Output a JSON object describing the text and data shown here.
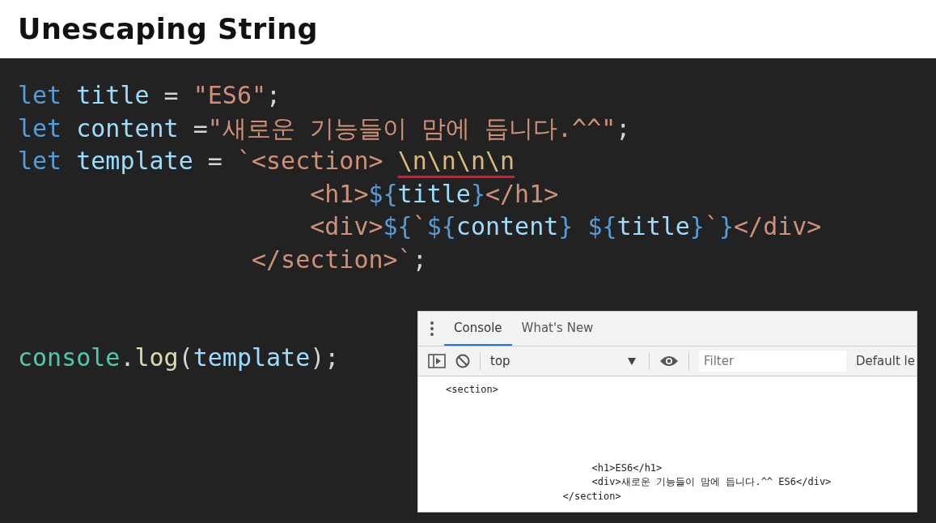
{
  "slide_title": "Unescaping String",
  "code_lines": [
    [
      {
        "kind": "keyword",
        "text": "let"
      },
      {
        "kind": "variable",
        "text": " title"
      },
      {
        "kind": "plain",
        "text": " = "
      },
      {
        "kind": "string",
        "text": "\"ES6\""
      },
      {
        "kind": "plain",
        "text": ";"
      }
    ],
    [
      {
        "kind": "keyword",
        "text": "let"
      },
      {
        "kind": "variable",
        "text": " content"
      },
      {
        "kind": "plain",
        "text": " ="
      },
      {
        "kind": "string",
        "text": "\"새로운 기능들이 맘에 듭니다.^^\""
      },
      {
        "kind": "plain",
        "text": ";"
      }
    ],
    [
      {
        "kind": "keyword",
        "text": "let"
      },
      {
        "kind": "variable",
        "text": " template"
      },
      {
        "kind": "plain",
        "text": " = "
      },
      {
        "kind": "string",
        "text": "`<section> "
      },
      {
        "kind": "escape",
        "text": "\\n\\n\\n\\n",
        "underlined": true
      }
    ],
    [
      {
        "kind": "string",
        "text": "                    <h1>"
      },
      {
        "kind": "interp",
        "text": "${"
      },
      {
        "kind": "variable",
        "text": "title"
      },
      {
        "kind": "interp",
        "text": "}"
      },
      {
        "kind": "string",
        "text": "</h1>"
      }
    ],
    [
      {
        "kind": "string",
        "text": "                    <div>"
      },
      {
        "kind": "interp",
        "text": "${"
      },
      {
        "kind": "string",
        "text": "`"
      },
      {
        "kind": "interp",
        "text": "${"
      },
      {
        "kind": "variable",
        "text": "content"
      },
      {
        "kind": "interp",
        "text": "}"
      },
      {
        "kind": "interp",
        "text": " ${"
      },
      {
        "kind": "variable",
        "text": "title"
      },
      {
        "kind": "interp",
        "text": "}"
      },
      {
        "kind": "string",
        "text": "`"
      },
      {
        "kind": "interp",
        "text": "}"
      },
      {
        "kind": "string",
        "text": "</div>"
      }
    ],
    [
      {
        "kind": "string",
        "text": "                </section>`"
      },
      {
        "kind": "plain",
        "text": ";"
      }
    ]
  ],
  "log_line": [
    {
      "kind": "object",
      "text": "console"
    },
    {
      "kind": "plain",
      "text": "."
    },
    {
      "kind": "function",
      "text": "log"
    },
    {
      "kind": "plain",
      "text": "("
    },
    {
      "kind": "variable",
      "text": "template"
    },
    {
      "kind": "plain",
      "text": ");"
    }
  ],
  "devtools": {
    "tabs": [
      {
        "label": "Console",
        "selected": true
      },
      {
        "label": "What's New",
        "selected": false
      }
    ],
    "context": "top",
    "filter": {
      "placeholder": "Filter"
    },
    "levels": "Default le",
    "output_head": "<section>",
    "output": [
      "                         <h1>ES6</h1>",
      "                         <div>새로운 기능들이 맘에 듭니다.^^ ES6</div>",
      "                    </section>"
    ]
  }
}
